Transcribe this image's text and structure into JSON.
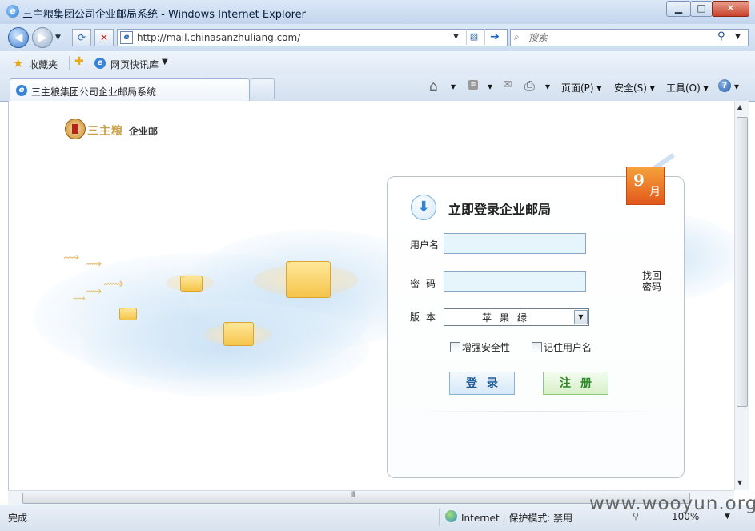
{
  "window": {
    "title": "三主粮集团公司企业邮局系统 - Windows Internet Explorer",
    "min": "▁",
    "max": "□",
    "close": "✕"
  },
  "nav": {
    "url": "http://mail.chinasanzhuliang.com/",
    "search_placeholder": "搜索"
  },
  "favorites": {
    "label": "收藏夹",
    "webslice": "网页快讯库"
  },
  "tab": {
    "title": "三主粮集团公司企业邮局系统"
  },
  "commands": {
    "page": "页面(P)",
    "safety": "安全(S)",
    "tools": "工具(O)"
  },
  "logo": {
    "brand": "三主粮",
    "text": "企业邮"
  },
  "calendar": {
    "day": "9",
    "month": "月"
  },
  "login": {
    "title": "立即登录企业邮局",
    "username_label": "用户名",
    "password_label": "密码",
    "version_label": "版本",
    "find_password": "找回密码",
    "version_value": "苹果绿",
    "secure_label": "增强安全性",
    "remember_label": "记住用户名",
    "login_button": "登录",
    "register_button": "注册"
  },
  "status": {
    "text": "完成",
    "zone": "Internet | 保护模式: 禁用",
    "zoom": "100%"
  },
  "watermark": "www.wooyun.org",
  "colors": {
    "accent": "#2d83d6",
    "login_button": "#1e5a94",
    "register_button": "#2b8a26",
    "calendar": "#e2581c"
  }
}
